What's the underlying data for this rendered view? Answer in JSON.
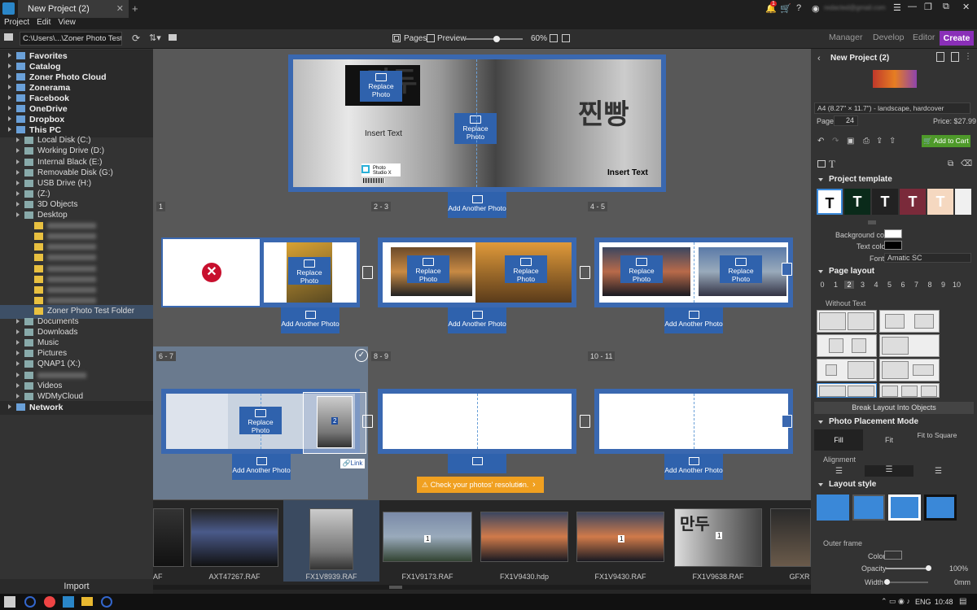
{
  "titlebar": {
    "tab": "New Project (2)",
    "plus": "+",
    "alerts": "1",
    "email": "redacted@gmail.com"
  },
  "menu": [
    "Project",
    "Edit",
    "View"
  ],
  "toolbar": {
    "path": "C:\\Users\\...\\Zoner Photo Test Folder",
    "pages": "Pages",
    "preview": "Preview",
    "zoom": "60%",
    "modes": [
      "Manager",
      "Develop",
      "Editor"
    ],
    "create": "Create"
  },
  "sidebar": {
    "items": [
      {
        "label": "Favorites",
        "hdr": true,
        "indent": 0
      },
      {
        "label": "Catalog",
        "hdr": true,
        "indent": 0
      },
      {
        "label": "Zoner Photo Cloud",
        "hdr": true,
        "indent": 0
      },
      {
        "label": "Zonerama",
        "hdr": true,
        "indent": 0
      },
      {
        "label": "Facebook",
        "hdr": true,
        "indent": 0
      },
      {
        "label": "OneDrive",
        "hdr": true,
        "indent": 0
      },
      {
        "label": "Dropbox",
        "hdr": true,
        "indent": 0
      },
      {
        "label": "This PC",
        "hdr": true,
        "indent": 0
      },
      {
        "label": "Local Disk (C:)",
        "indent": 1
      },
      {
        "label": "Working Drive (D:)",
        "indent": 1
      },
      {
        "label": "Internal Black (E:)",
        "indent": 1
      },
      {
        "label": "Removable Disk (G:)",
        "indent": 1
      },
      {
        "label": "USB Drive (H:)",
        "indent": 1
      },
      {
        "label": "(Z:)",
        "indent": 1
      },
      {
        "label": "3D Objects",
        "indent": 1
      },
      {
        "label": "Desktop",
        "indent": 1
      },
      {
        "label": "",
        "indent": 2
      },
      {
        "label": "",
        "indent": 2
      },
      {
        "label": "",
        "indent": 2
      },
      {
        "label": "",
        "indent": 2
      },
      {
        "label": "",
        "indent": 2
      },
      {
        "label": "",
        "indent": 2
      },
      {
        "label": "",
        "indent": 2
      },
      {
        "label": "",
        "indent": 2
      },
      {
        "label": "Zoner Photo Test Folder",
        "indent": 2,
        "sel": true
      },
      {
        "label": "Documents",
        "indent": 1
      },
      {
        "label": "Downloads",
        "indent": 1
      },
      {
        "label": "Music",
        "indent": 1
      },
      {
        "label": "Pictures",
        "indent": 1
      },
      {
        "label": "QNAP1 (X:)",
        "indent": 1
      },
      {
        "label": "",
        "indent": 1
      },
      {
        "label": "Videos",
        "indent": 1
      },
      {
        "label": "WDMyCloud",
        "indent": 1
      },
      {
        "label": "Network",
        "hdr": true,
        "indent": 0
      }
    ],
    "import": "Import"
  },
  "canvas": {
    "replace": "Replace Photo",
    "add": "Add Another Photo",
    "insert_text": "Insert Text",
    "logo_text": "Photo Studio X",
    "page_nums": [
      "1",
      "2 - 3",
      "4 - 5",
      "6 - 7",
      "8 - 9",
      "10 - 11"
    ],
    "link": "Link",
    "badge": "2",
    "warning": "Check your photos' resolution.",
    "sign_left": "만두",
    "sign_right": "찐빵"
  },
  "filmstrip": {
    "files": [
      "AF",
      "AXT47267.RAF",
      "FX1V8939.RAF",
      "FX1V9173.RAF",
      "FX1V9430.hdp",
      "FX1V9430.RAF",
      "FX1V9638.RAF",
      "GFXR"
    ],
    "count": "1"
  },
  "rightpanel": {
    "title": "New Project (2)",
    "format": "A4 (8.27\" × 11.7\") - landscape, hardcover",
    "pages_label": "Pages:",
    "pages_value": "24",
    "price": "Price: $27.99",
    "add_to_cart": "Add to Cart",
    "project_template": "Project template",
    "template_letter": "T",
    "background_color": "Background color",
    "text_color": "Text color",
    "font_label": "Font",
    "font_value": "Amatic SC",
    "page_layout": "Page layout",
    "layout_nums": [
      "0",
      "1",
      "2",
      "3",
      "4",
      "5",
      "6",
      "7",
      "8",
      "9",
      "10"
    ],
    "without_text": "Without Text",
    "break_layout": "Break Layout Into Objects",
    "placement_mode": "Photo Placement Mode",
    "fill": "Fill",
    "fit": "Fit",
    "fit_square": "Fit to Square",
    "alignment": "Alignment",
    "layout_style": "Layout style",
    "outer_frame": "Outer frame",
    "color": "Color",
    "opacity": "Opacity",
    "opacity_value": "100%",
    "width": "Width",
    "width_value": "0mm"
  },
  "taskbar": {
    "lang": "ENG",
    "time": "10:48"
  },
  "colors": {
    "accent": "#8a2fb8",
    "blue": "#2f62ad",
    "cart": "#4e9a2a",
    "warning": "#f0a020"
  }
}
